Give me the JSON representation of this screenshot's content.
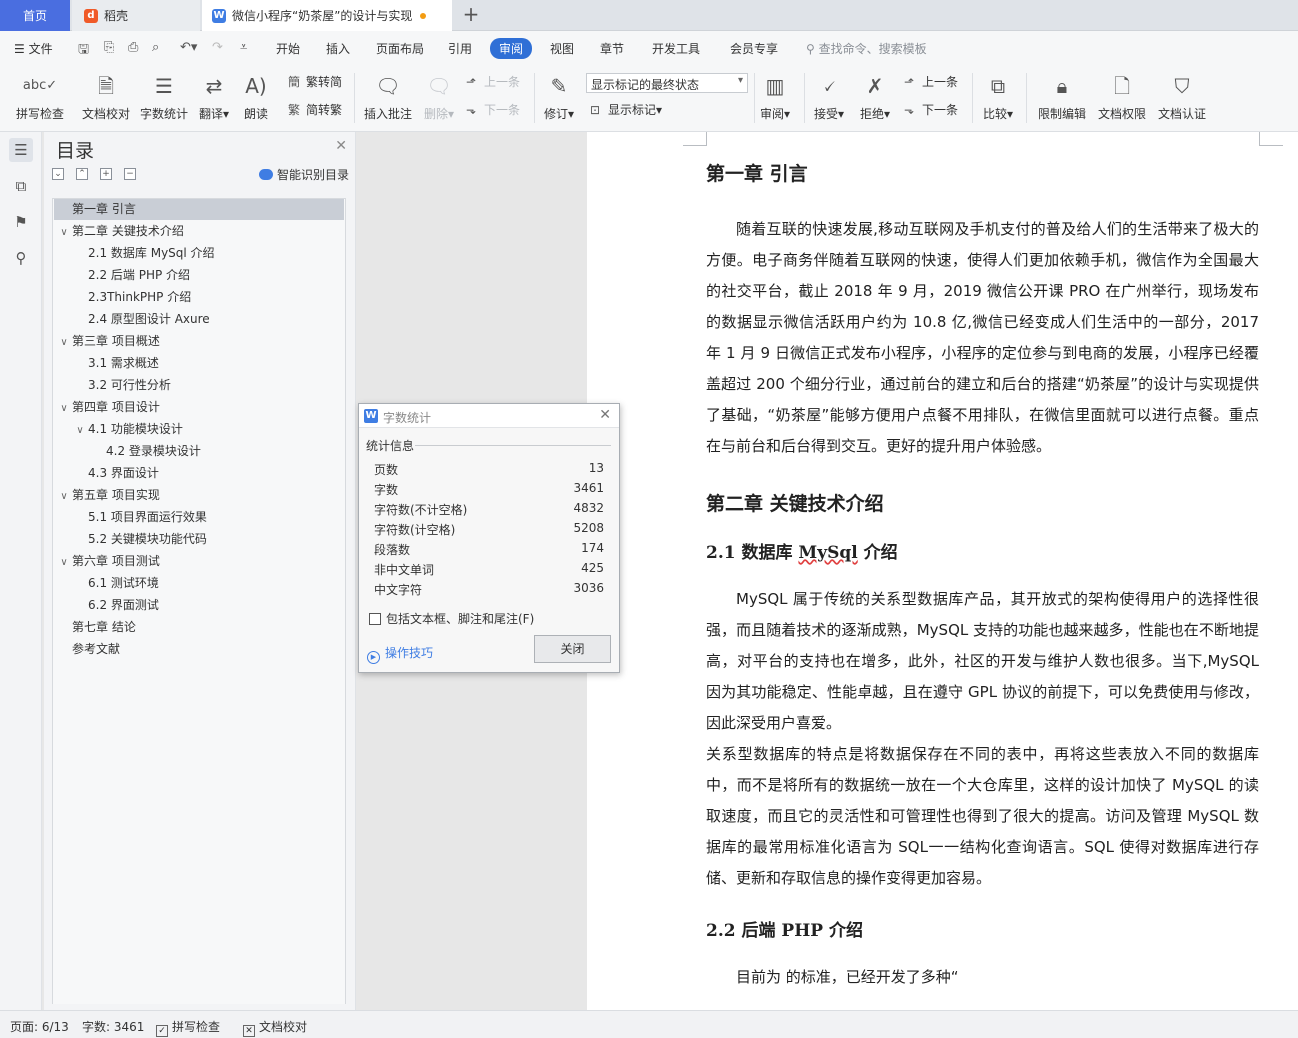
{
  "tabs": {
    "home": "首页",
    "daoke": "稻壳",
    "doc": "微信小程序“奶茶屋”的设计与实现",
    "add": "+"
  },
  "menu": {
    "file": "文件",
    "items": [
      "开始",
      "插入",
      "页面布局",
      "引用",
      "审阅",
      "视图",
      "章节",
      "开发工具",
      "会员专享"
    ],
    "search_placeholder": "查找命令、搜索模板"
  },
  "ribbon": {
    "spell_check": "拼写检查",
    "doc_proof": "文档校对",
    "word_count": "字数统计",
    "translate": "翻译",
    "read_aloud": "朗读",
    "trad_to_simp": "繁转简",
    "simp_to_trad": "简转繁",
    "insert_comment": "插入批注",
    "delete": "删除",
    "prev": "上一条",
    "next": "下一条",
    "revise": "修订",
    "markup_mode": "显示标记的最终状态",
    "show_markup": "显示标记",
    "review": "审阅",
    "accept": "接受",
    "reject": "拒绝",
    "prev2": "上一条",
    "next2": "下一条",
    "compare": "比较",
    "restrict_edit": "限制编辑",
    "doc_permission": "文档权限",
    "doc_auth": "文档认证"
  },
  "toc": {
    "title": "目录",
    "smart": "智能识别目录",
    "items": [
      {
        "label": "第一章 引言",
        "level": 1,
        "arrow": "",
        "selected": true
      },
      {
        "label": "第二章  关键技术介绍",
        "level": 1,
        "arrow": "∨"
      },
      {
        "label": "2.1 数据库  MySql 介绍",
        "level": 2,
        "arrow": ""
      },
      {
        "label": "2.2 后端 PHP 介绍",
        "level": 2,
        "arrow": ""
      },
      {
        "label": "2.3ThinkPHP 介绍",
        "level": 2,
        "arrow": ""
      },
      {
        "label": "2.4 原型图设计 Axure",
        "level": 2,
        "arrow": ""
      },
      {
        "label": "第三章  项目概述",
        "level": 1,
        "arrow": "∨"
      },
      {
        "label": "3.1 需求概述",
        "level": 2,
        "arrow": ""
      },
      {
        "label": "3.2 可行性分析",
        "level": 2,
        "arrow": ""
      },
      {
        "label": "第四章  项目设计",
        "level": 1,
        "arrow": "∨"
      },
      {
        "label": "4.1 功能模块设计",
        "level": 2,
        "arrow": "∨"
      },
      {
        "label": "4.2 登录模块设计",
        "level": 3,
        "arrow": ""
      },
      {
        "label": "4.3 界面设计",
        "level": 2,
        "arrow": ""
      },
      {
        "label": "第五章  项目实现",
        "level": 1,
        "arrow": "∨"
      },
      {
        "label": "5.1 项目界面运行效果",
        "level": 2,
        "arrow": ""
      },
      {
        "label": "5.2 关键模块功能代码",
        "level": 2,
        "arrow": ""
      },
      {
        "label": "第六章  项目测试",
        "level": 1,
        "arrow": "∨"
      },
      {
        "label": "6.1 测试环境",
        "level": 2,
        "arrow": ""
      },
      {
        "label": "6.2 界面测试",
        "level": 2,
        "arrow": ""
      },
      {
        "label": "第七章  结论",
        "level": 1,
        "arrow": ""
      },
      {
        "label": "参考文献",
        "level": 1,
        "arrow": ""
      }
    ]
  },
  "dialog": {
    "title": "字数统计",
    "section": "统计信息",
    "stats": [
      {
        "label": "页数",
        "value": "13"
      },
      {
        "label": "字数",
        "value": "3461"
      },
      {
        "label": "字符数(不计空格)",
        "value": "4832"
      },
      {
        "label": "字符数(计空格)",
        "value": "5208"
      },
      {
        "label": "段落数",
        "value": "174"
      },
      {
        "label": "非中文单词",
        "value": "425"
      },
      {
        "label": "中文字符",
        "value": "3036"
      }
    ],
    "checkbox": "包括文本框、脚注和尾注(F)",
    "tips": "操作技巧",
    "close": "关闭"
  },
  "doc": {
    "ch1_title": "第一章  引言",
    "ch1_p1": "随着互联的快速发展,移动互联网及手机支付的普及给人们的生活带来了极大的方便。电子商务伴随着互联网的快速，使得人们更加依赖手机，微信作为全国最大的社交平台，截止 2018 年 9 月，2019 微信公开课 PRO 在广州举行，现场发布的数据显示微信活跃用户约为 10.8 亿,微信已经变成人们生活中的一部分，2017 年 1 月 9 日微信正式发布小程序，小程序的定位参与到电商的发展，小程序已经覆盖超过 200 个细分行业，通过前台的建立和后台的搭建“奶茶屋”的设计与实现提供了基础，“奶茶屋”能够方便用户点餐不用排队，在微信里面就可以进行点餐。重点在与前台和后台得到交互。更好的提升用户体验感。",
    "ch2_title": "第二章  关键技术介绍",
    "s21_prefix": "2.1 数据库  ",
    "s21_wavy": "MySql",
    "s21_suffix": " 介绍",
    "s21_p1": "MySQL 属于传统的关系型数据库产品，其开放式的架构使得用户的选择性很强，而且随着技术的逐渐成熟，MySQL 支持的功能也越来越多，性能也在不断地提高，对平台的支持也在增多，此外，社区的开发与维护人数也很多。当下,MySQL 因为其功能稳定、性能卓越，且在遵守 GPL 协议的前提下，可以免费使用与修改，因此深受用户喜爱。",
    "s21_p2": "关系型数据库的特点是将数据保存在不同的表中，再将这些表放入不同的数据库中，而不是将所有的数据统一放在一个大仓库里，这样的设计加快了 MySQL 的读取速度，而且它的灵活性和可管理性也得到了很大的提高。访问及管理 MySQL 数据库的最常用标准化语言为 SQL一一结构化查询语言。SQL 使得对数据库进行存储、更新和存取信息的操作变得更加容易。",
    "s22_title": "2.2 后端 PHP 介绍",
    "s22_partial": "   目前为             的标准，已经开发了多种“"
  },
  "status": {
    "page": "页面: 6/13",
    "words": "字数: 3461",
    "spell": "拼写检查",
    "proof": "文档校对"
  },
  "colors": {
    "accent": "#2f6fd6",
    "home_tab": "#4a6ee0",
    "wps_icon": "#3f7de3"
  }
}
